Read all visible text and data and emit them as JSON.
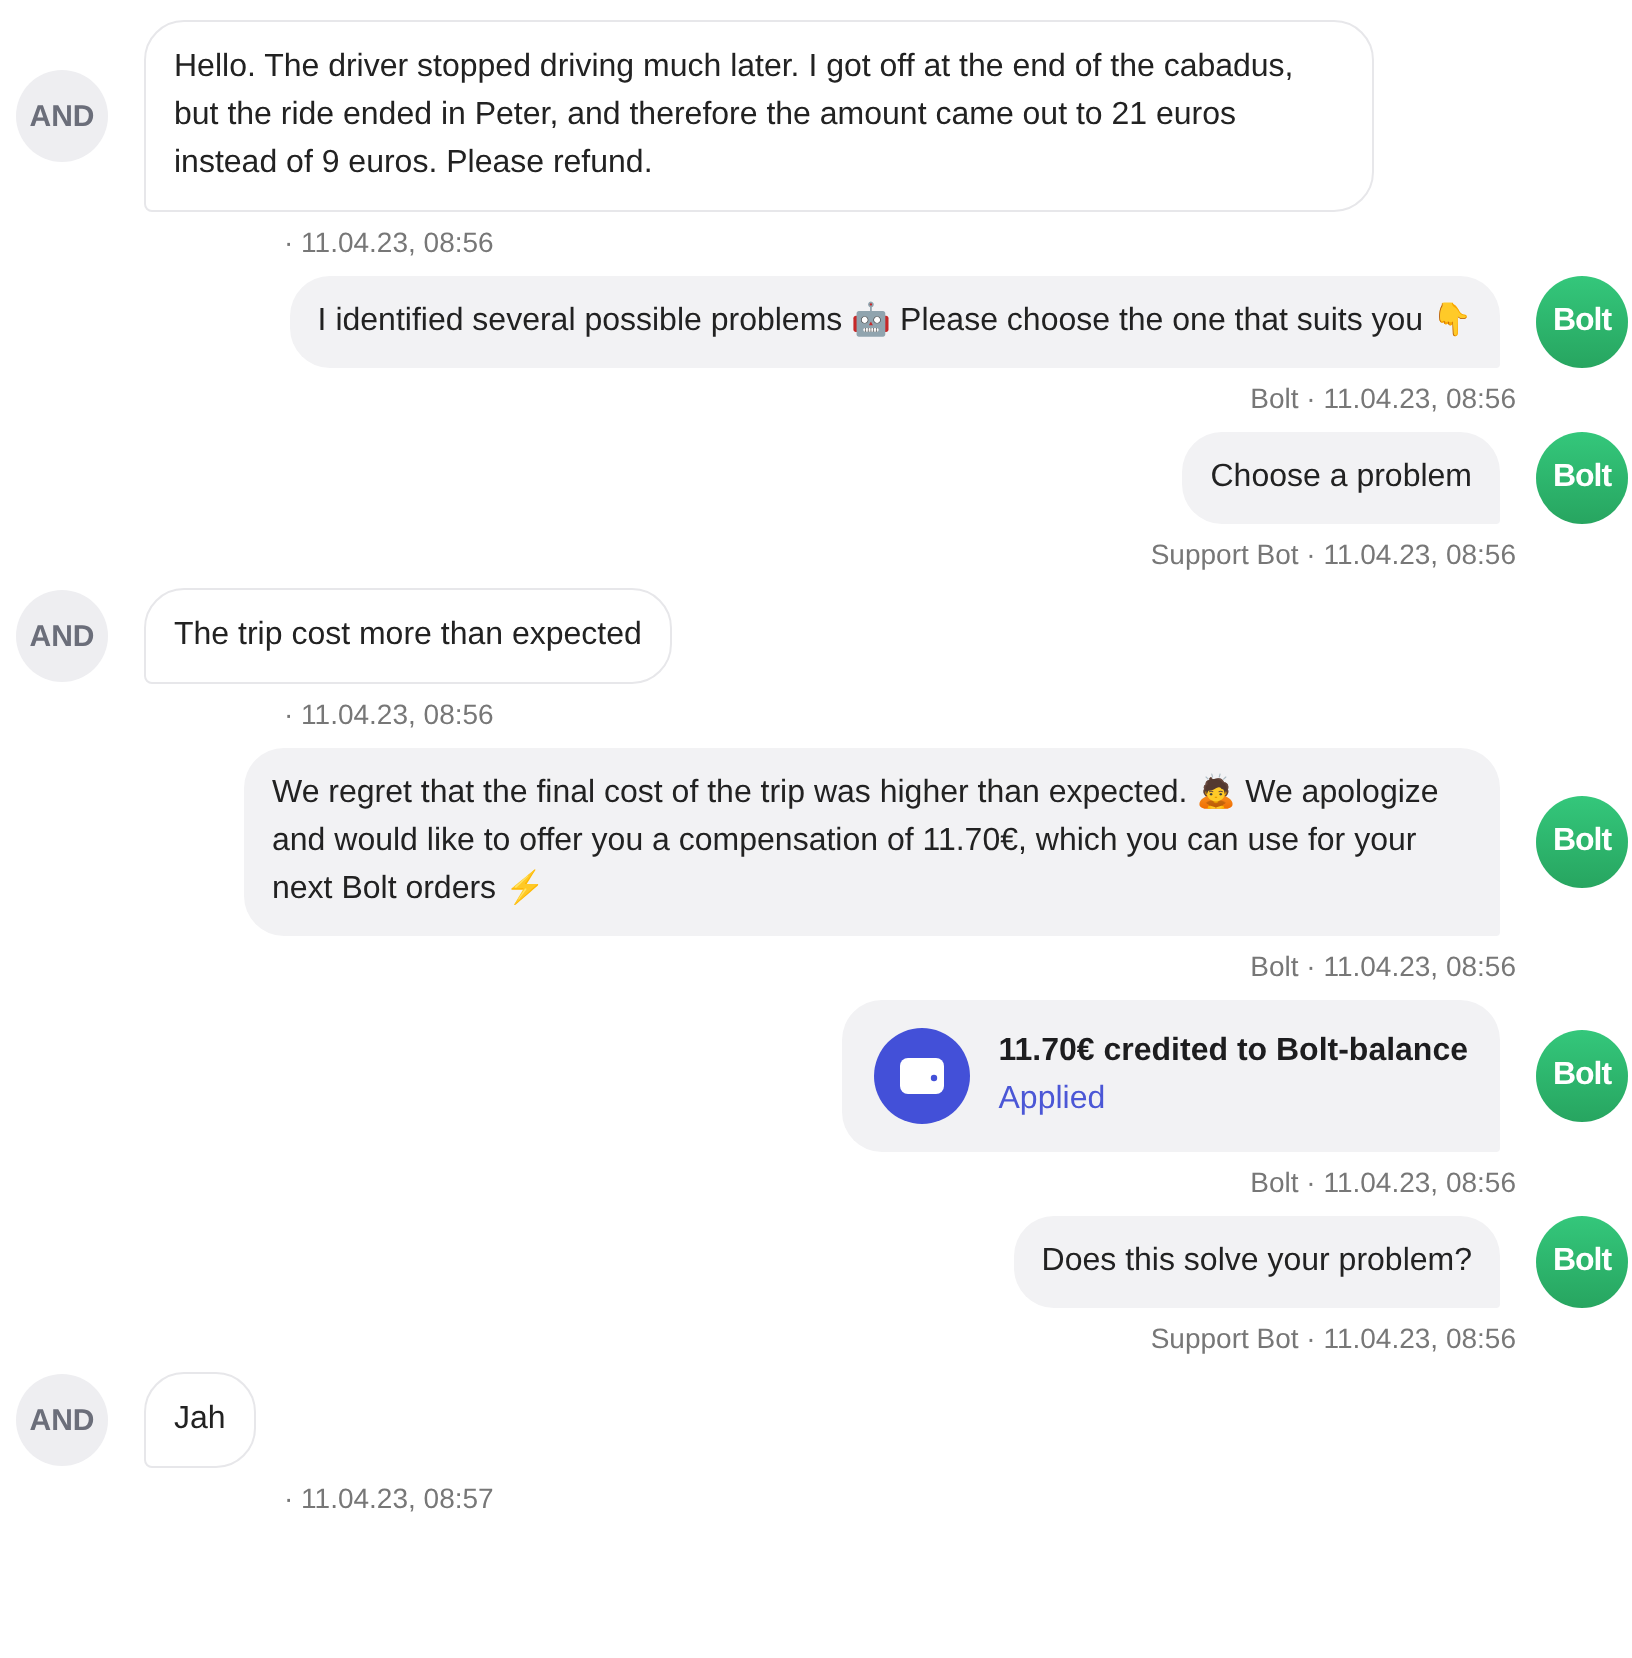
{
  "messages": [
    {
      "from_bot": false,
      "kind": "text",
      "avatar": "AND",
      "text": "Hello. The driver stopped driving much later. I got off at the end of the cabadus, but the ride ended in Peter, and therefore the amount came out to 21 euros instead of 9 euros. Please refund.",
      "meta": "· 11.04.23, 08:56"
    },
    {
      "from_bot": true,
      "kind": "text",
      "avatar": "Bolt",
      "text": "I identified several possible problems 🤖 Please choose the one that suits you 👇",
      "meta": "Bolt · 11.04.23, 08:56"
    },
    {
      "from_bot": true,
      "kind": "text",
      "avatar": "Bolt",
      "text": "Choose a problem",
      "meta": "Support Bot · 11.04.23, 08:56"
    },
    {
      "from_bot": false,
      "kind": "text",
      "avatar": "AND",
      "text": "The trip cost more than expected",
      "meta": "· 11.04.23, 08:56"
    },
    {
      "from_bot": true,
      "kind": "text",
      "avatar": "Bolt",
      "text": "We regret that the final cost of the trip was higher than expected. 🙇 We apologize and would like to offer you a compensation of 11.70€, which you can use for your next Bolt orders ⚡",
      "meta": "Bolt · 11.04.23, 08:56"
    },
    {
      "from_bot": true,
      "kind": "card",
      "avatar": "Bolt",
      "title": "11.70€ credited to Bolt-balance",
      "status": "Applied",
      "meta": "Bolt · 11.04.23, 08:56"
    },
    {
      "from_bot": true,
      "kind": "text",
      "avatar": "Bolt",
      "text": "Does this solve your problem?",
      "meta": "Support Bot · 11.04.23, 08:56"
    },
    {
      "from_bot": false,
      "kind": "text",
      "avatar": "AND",
      "text": "Jah",
      "meta": "· 11.04.23, 08:57"
    }
  ]
}
